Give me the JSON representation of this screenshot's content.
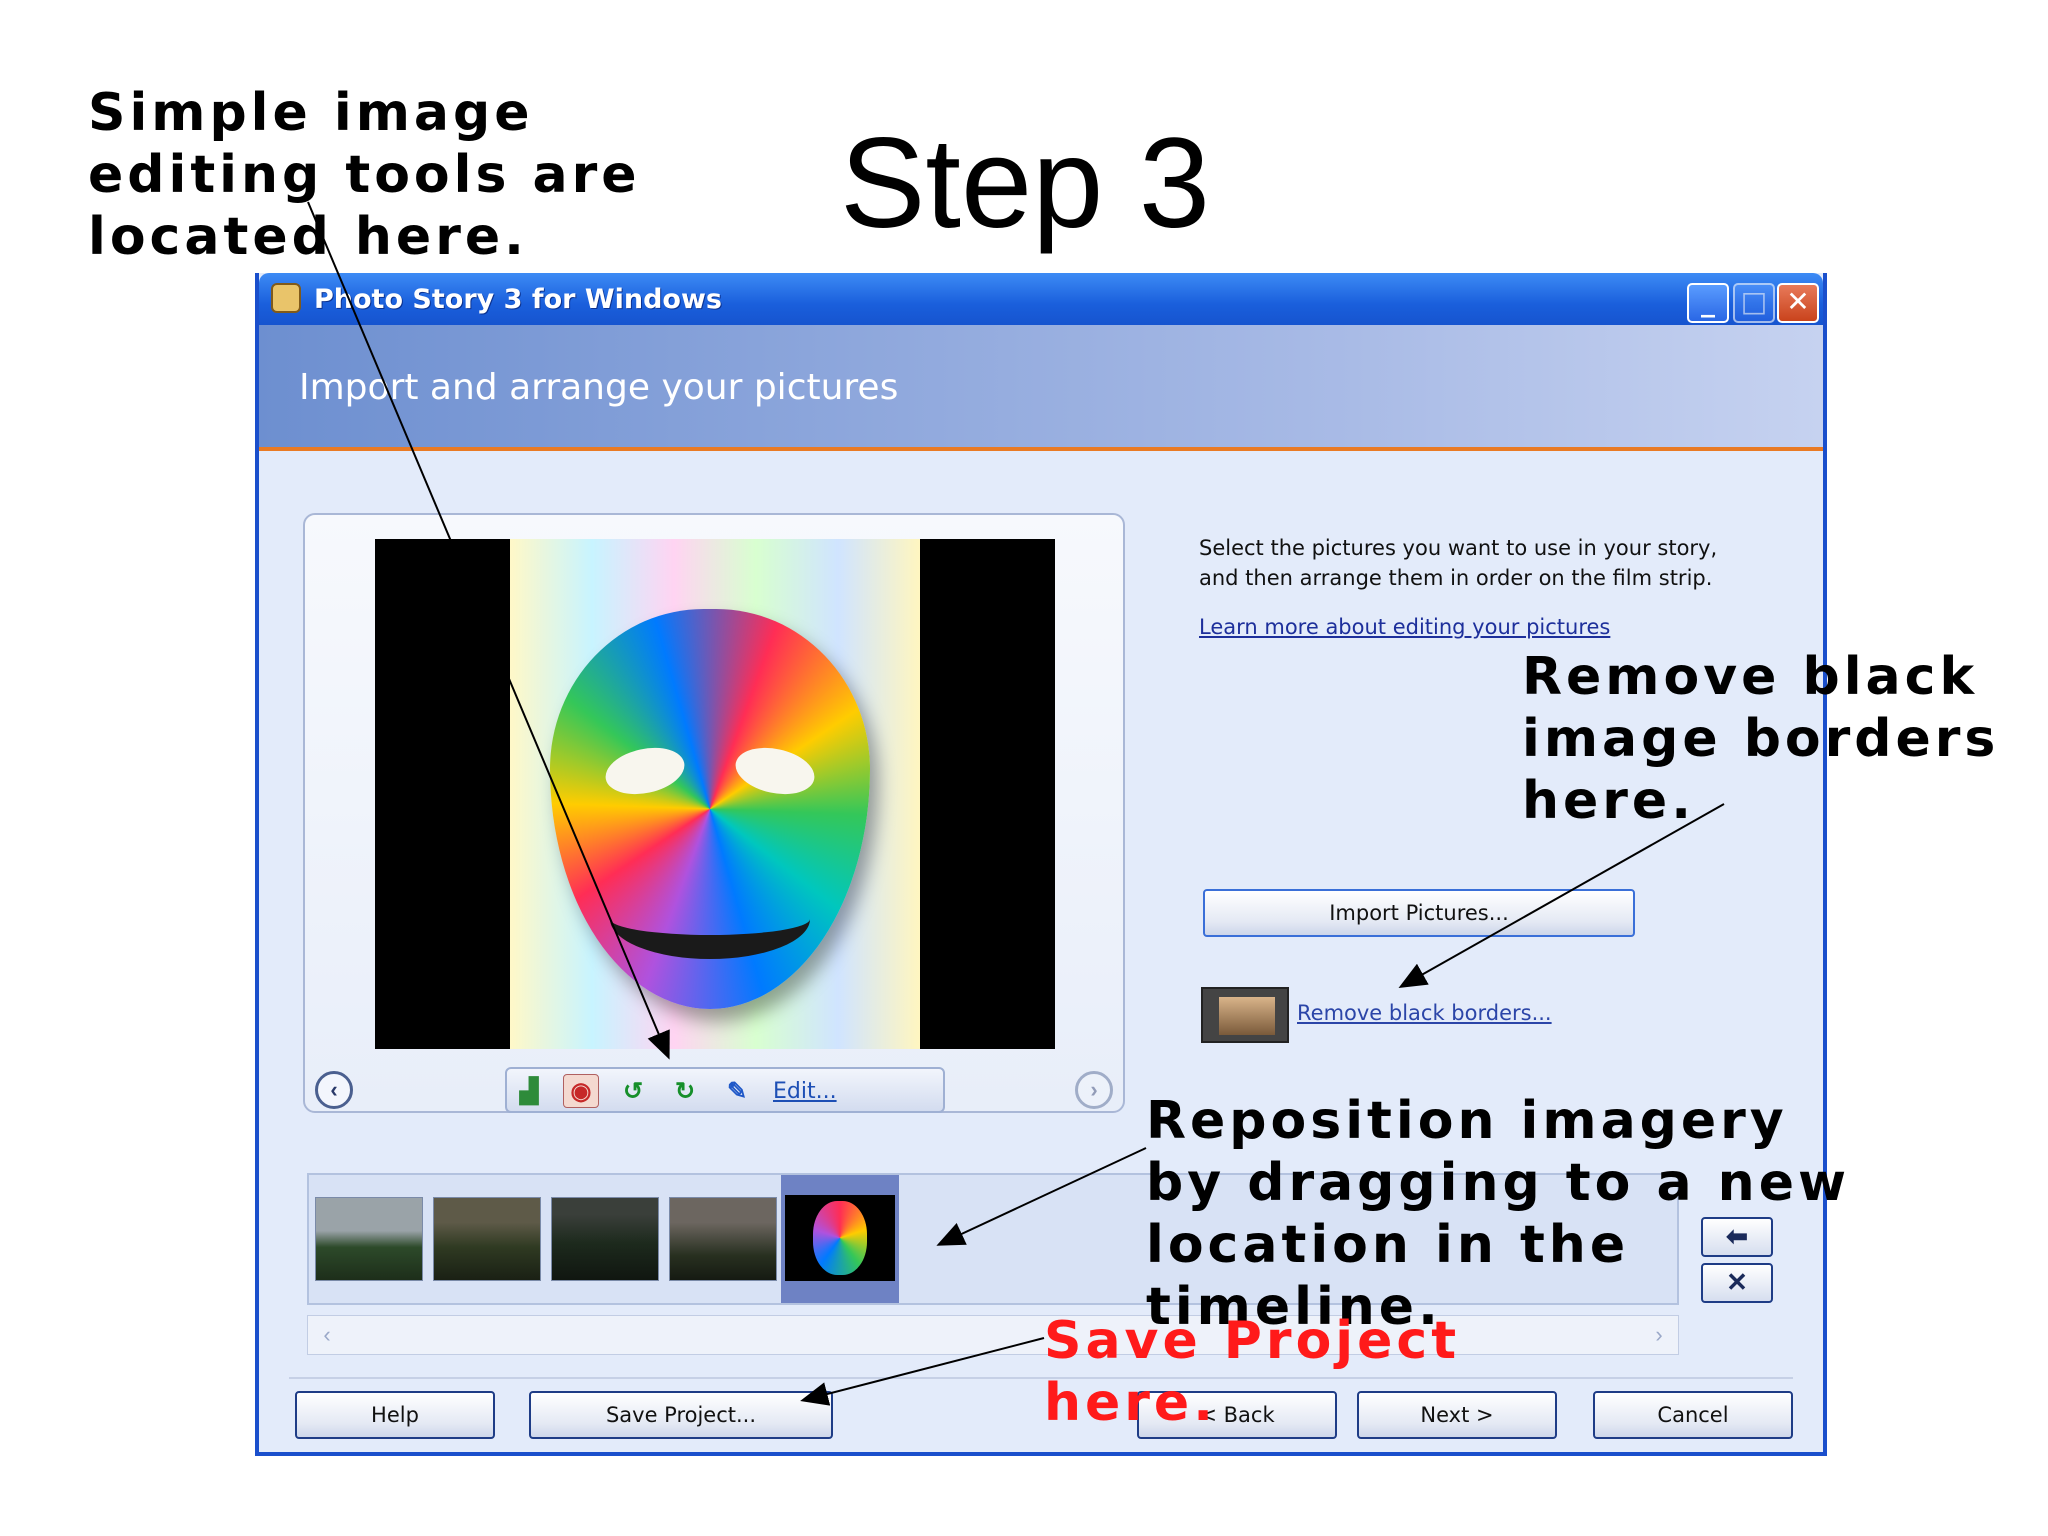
{
  "slide": {
    "title": "Step 3"
  },
  "callouts": {
    "tools": "Simple image\nediting tools are\nlocated here.",
    "borders": "Remove black\nimage borders\nhere.",
    "reposition": "Reposition imagery\nby dragging to a new\nlocation in the\ntimeline.",
    "save": "Save Project\nhere.",
    "save_color": "#ff1a1a"
  },
  "window": {
    "title": "Photo Story 3 for Windows",
    "heading": "Import and arrange your pictures"
  },
  "instructions": {
    "text": "Select the pictures you want to use in your story, and then arrange them in order on the film strip.",
    "learn_link": "Learn more about editing your pictures"
  },
  "actions": {
    "import_label": "Import Pictures...",
    "remove_borders_label": "Remove black borders...",
    "edit_label": "Edit..."
  },
  "toolbar": {
    "icons": [
      "auto-levels-icon",
      "red-eye-icon",
      "rotate-left-icon",
      "rotate-right-icon",
      "edit-icon"
    ]
  },
  "filmstrip": {
    "thumbnail_count": 5,
    "selected_index": 4
  },
  "footer": {
    "help_label": "Help",
    "save_label": "Save Project...",
    "back_label": "< Back",
    "next_label": "Next >",
    "cancel_label": "Cancel"
  },
  "colors": {
    "titlebar": "#1a5fdc",
    "accent_rule": "#e97a24",
    "window_bg": "#e3ebfa"
  }
}
